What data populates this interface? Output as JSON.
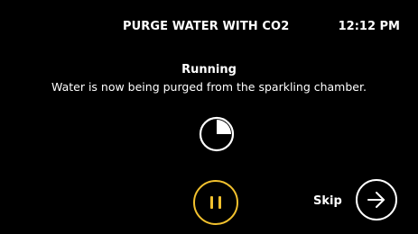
{
  "header": {
    "title": "PURGE WATER WITH CO2",
    "time": "12:12 PM"
  },
  "status": {
    "title": "Running",
    "message": "Water is now being purged from the sparkling chamber."
  },
  "progress": {
    "icon": "progress-pie-icon",
    "fraction": 0.25
  },
  "controls": {
    "pause_icon": "pause-icon",
    "skip_label": "Skip",
    "skip_icon": "arrow-right-icon"
  },
  "colors": {
    "background": "#000000",
    "text": "#ffffff",
    "accent": "#f2c12e"
  }
}
